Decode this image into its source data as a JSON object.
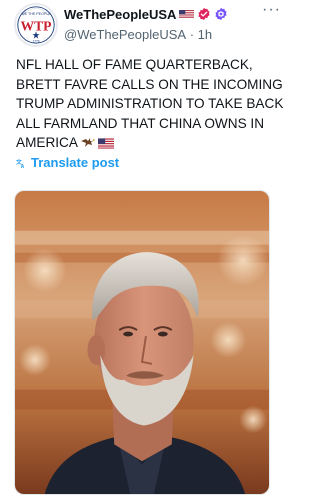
{
  "account": {
    "display_name": "WeThePeopleUSA",
    "handle": "@WeThePeopleUSA",
    "separator": "·",
    "time_ago": "1h",
    "avatar_text": "WTP",
    "avatar_top_text": "WE THE PEOPLE",
    "avatar_year": "1776"
  },
  "badges": [
    "us-flag-icon",
    "verified-badge-icon",
    "affiliate-badge-icon"
  ],
  "menu_label": "···",
  "post": {
    "text": "NFL HALL OF FAME QUARTERBACK, BRETT FAVRE CALLS ON THE INCOMING TRUMP ADMINISTRATION TO TAKE BACK ALL FARMLAND THAT CHINA OWNS IN AMERICA",
    "trailing_emoji": [
      "eagle-icon",
      "us-flag-icon"
    ]
  },
  "translate": {
    "label": "Translate post",
    "icon": "translate-icon"
  },
  "colors": {
    "link": "#1d9bf0",
    "verified": "#e0245e",
    "affiliate": "#7856ff",
    "secondary_text": "#536471"
  }
}
